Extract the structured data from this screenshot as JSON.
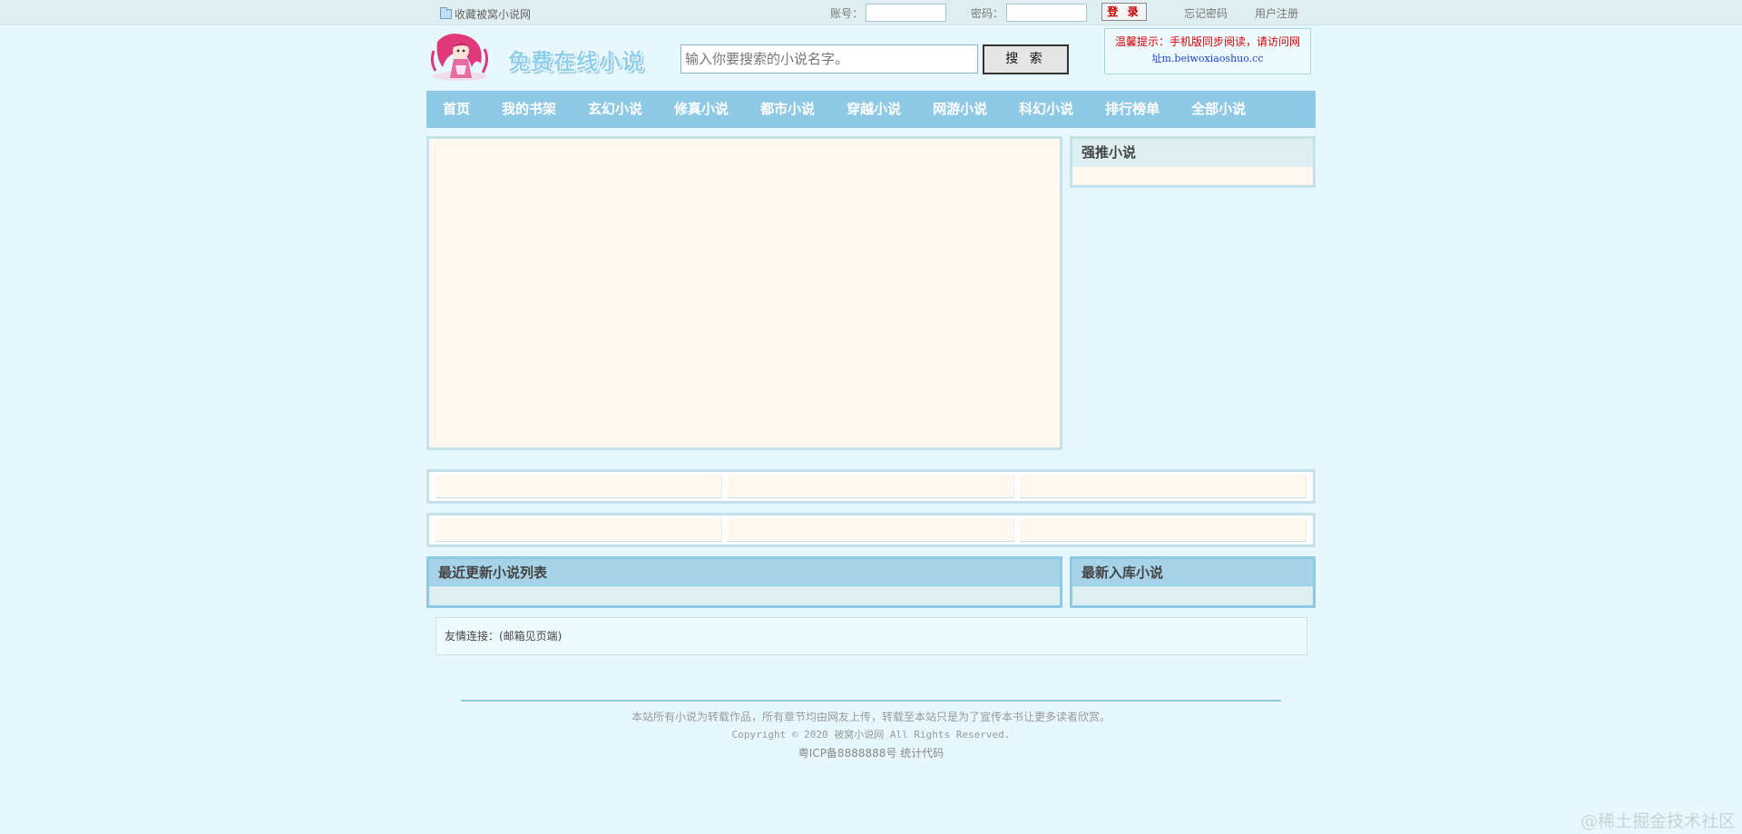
{
  "topbar": {
    "favorite": "收藏被窝小说网",
    "account_label": "账号：",
    "account_value": "",
    "password_label": "密码：",
    "password_value": "",
    "login_label": "登 录",
    "forgot": "忘记密码",
    "register": "用户注册"
  },
  "header": {
    "logo_text": "免费在线小说",
    "search_placeholder": "输入你要搜索的小说名字。",
    "search_button": "搜 索",
    "tip_line1": "温馨提示：手机版同步阅读，请访问网",
    "tip_line2": "址m.beiwoxiaoshuo.cc"
  },
  "nav": {
    "items": [
      "首页",
      "我的书架",
      "玄幻小说",
      "修真小说",
      "都市小说",
      "穿越小说",
      "网游小说",
      "科幻小说",
      "排行榜单",
      "全部小说"
    ]
  },
  "sidebar": {
    "recommend_title": "强推小说"
  },
  "panels": {
    "latest_updates": "最近更新小说列表",
    "newest": "最新入库小说"
  },
  "friends": {
    "text": "友情连接：(邮箱见页端)"
  },
  "footer": {
    "line1": "本站所有小说为转载作品，所有章节均由网友上传，转载至本站只是为了宣传本书让更多读者欣赏。",
    "line2": "Copyright © 2020 被窝小说网 All Rights Reserved.",
    "line3": "粤ICP备8888888号 统计代码"
  },
  "watermark": "@稀土掘金技术社区",
  "colors": {
    "page_bg": "#e6f8fd",
    "nav_bg": "#8ec9e5",
    "box_bg": "#fff8ee",
    "tip_red": "#dd0000",
    "tip_blue": "#1a3ccf"
  }
}
